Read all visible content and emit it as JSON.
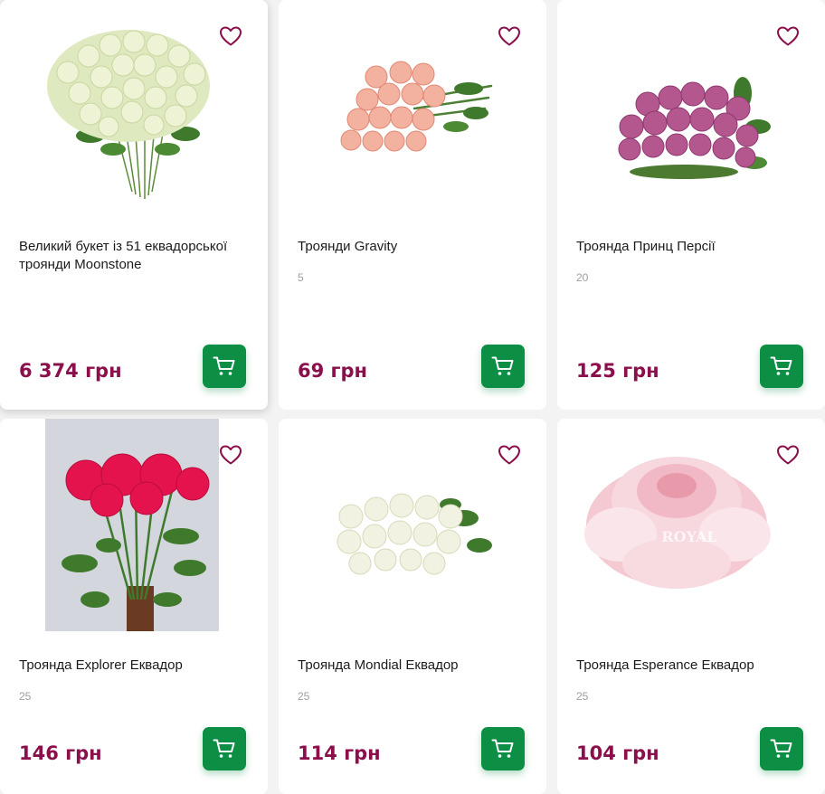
{
  "colors": {
    "accent": "#8a0f4b",
    "cart": "#0c8f45",
    "background": "#f3f3f3"
  },
  "products": [
    {
      "name": "Великий букет із 51 еквадорської троянди Moonstone",
      "quantity": "",
      "price": "6 374 грн",
      "image": "white-rose-bouquet",
      "fav_icon": "heart-icon",
      "cart_icon": "cart-icon"
    },
    {
      "name": "Троянди Gravity",
      "quantity": "5",
      "price": "69 грн",
      "image": "peach-roses",
      "fav_icon": "heart-icon",
      "cart_icon": "cart-icon"
    },
    {
      "name": "Троянда Принц Персії",
      "quantity": "20",
      "price": "125 грн",
      "image": "purple-roses",
      "fav_icon": "heart-icon",
      "cart_icon": "cart-icon"
    },
    {
      "name": "Троянда Explorer Еквадор",
      "quantity": "25",
      "price": "146 грн",
      "image": "red-roses-vase",
      "fav_icon": "heart-icon",
      "cart_icon": "cart-icon"
    },
    {
      "name": "Троянда Mondial Еквадор",
      "quantity": "25",
      "price": "114 грн",
      "image": "white-roses",
      "fav_icon": "heart-icon",
      "cart_icon": "cart-icon"
    },
    {
      "name": "Троянда Esperance Еквадор",
      "quantity": "25",
      "price": "104 грн",
      "image": "pink-rose-closeup",
      "fav_icon": "heart-icon",
      "cart_icon": "cart-icon"
    }
  ],
  "image_watermark": "ROYAL"
}
